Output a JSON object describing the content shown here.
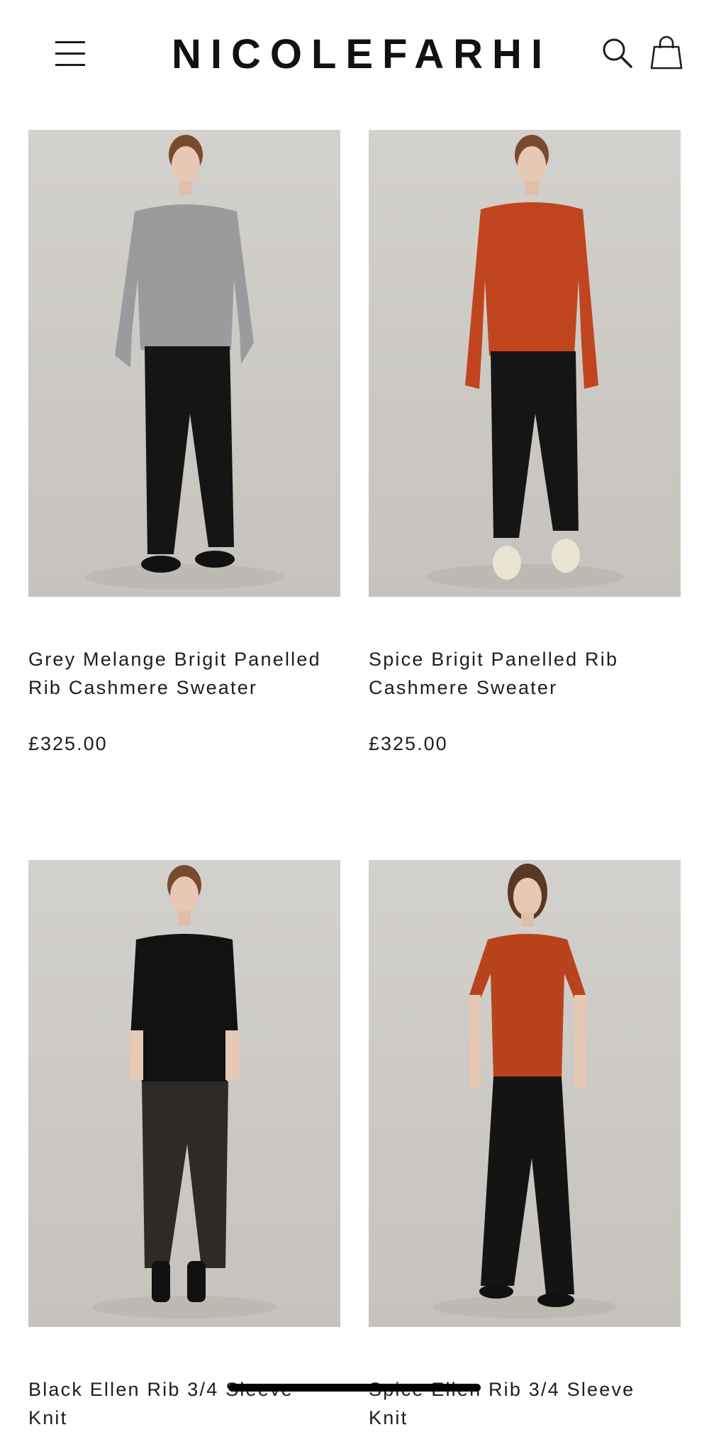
{
  "header": {
    "brand": "NICOLEFARHI",
    "menu_icon": "hamburger-menu-icon",
    "search_icon": "search-icon",
    "bag_icon": "shopping-bag-icon"
  },
  "products": [
    {
      "name": "Grey Melange Brigit Panelled Rib Cashmere Sweater",
      "price": "£325.00",
      "top_color": "#9a9b9d",
      "bottom_color": "#151515",
      "shoe_color": "#111111"
    },
    {
      "name": "Spice Brigit Panelled Rib Cashmere Sweater",
      "price": "£325.00",
      "top_color": "#c0451f",
      "bottom_color": "#151515",
      "shoe_color": "#e9e3d2"
    },
    {
      "name": "Black Ellen Rib 3/4 Sleeve Knit",
      "price": "",
      "top_color": "#121212",
      "bottom_color": "#2e2a27",
      "shoe_color": "#111111"
    },
    {
      "name": "Spice Ellen Rib 3/4 Sleeve Knit",
      "price": "",
      "top_color": "#b9431c",
      "bottom_color": "#141414",
      "shoe_color": "#111111"
    }
  ]
}
